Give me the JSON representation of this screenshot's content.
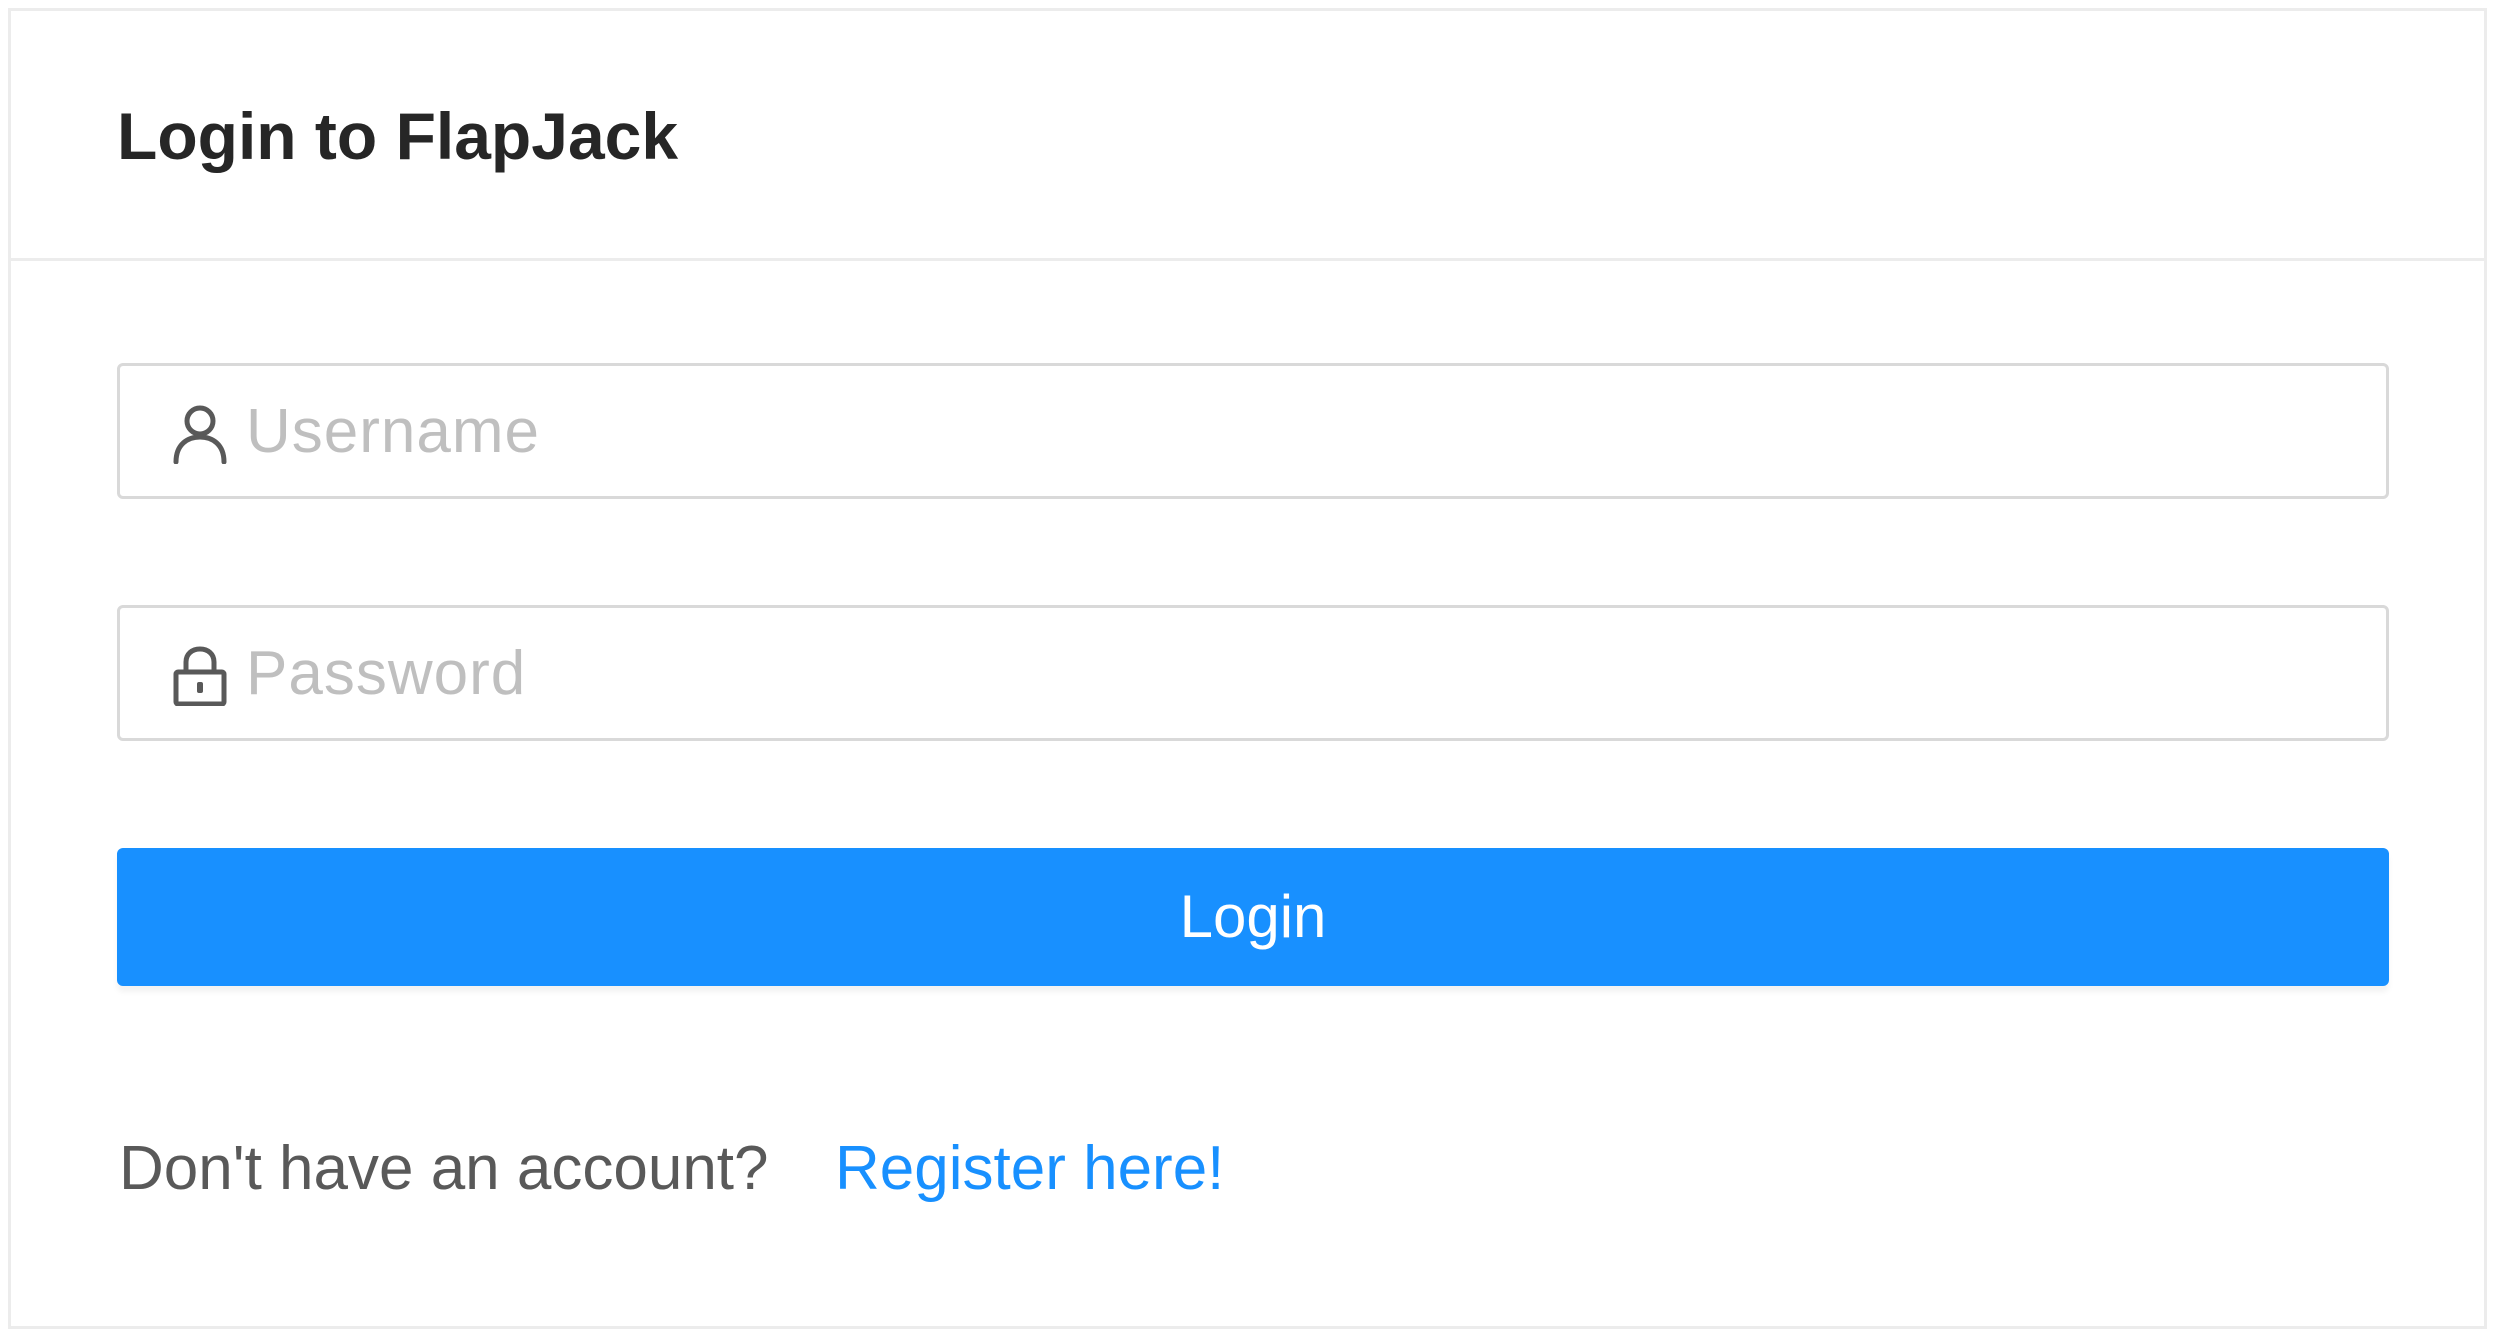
{
  "header": {
    "title": "Login to FlapJack"
  },
  "form": {
    "username": {
      "icon": "user-icon",
      "placeholder": "Username",
      "value": ""
    },
    "password": {
      "icon": "lock-icon",
      "placeholder": "Password",
      "value": ""
    },
    "submit_label": "Login"
  },
  "footer": {
    "prompt": "Don't have an account?",
    "register_link": "Register here!"
  },
  "colors": {
    "primary": "#1890ff",
    "border": "#d9d9d9",
    "placeholder": "#bfbfbf",
    "title": "#262626",
    "muted_text": "#595959"
  }
}
